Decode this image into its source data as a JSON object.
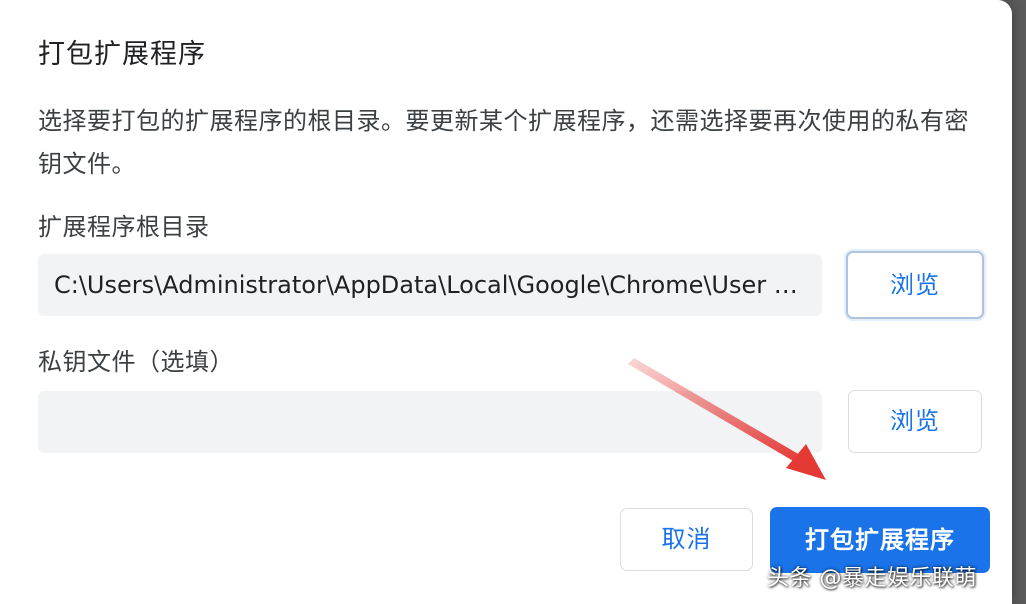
{
  "dialog": {
    "title": "打包扩展程序",
    "description": "选择要打包的扩展程序的根目录。要更新某个扩展程序，还需选择要再次使用的私有密钥文件。",
    "root_dir_label": "扩展程序根目录",
    "root_dir_value": "C:\\Users\\Administrator\\AppData\\Local\\Google\\Chrome\\User D...",
    "key_file_label": "私钥文件（选填）",
    "key_file_value": "",
    "browse_label": "浏览",
    "cancel_label": "取消",
    "pack_label": "打包扩展程序"
  },
  "annotation": {
    "arrow_color": "#e53935"
  },
  "watermark": {
    "text": "头条 @暴走娱乐联萌"
  },
  "colors": {
    "primary": "#1a73e8",
    "field_bg": "#f1f3f4"
  }
}
